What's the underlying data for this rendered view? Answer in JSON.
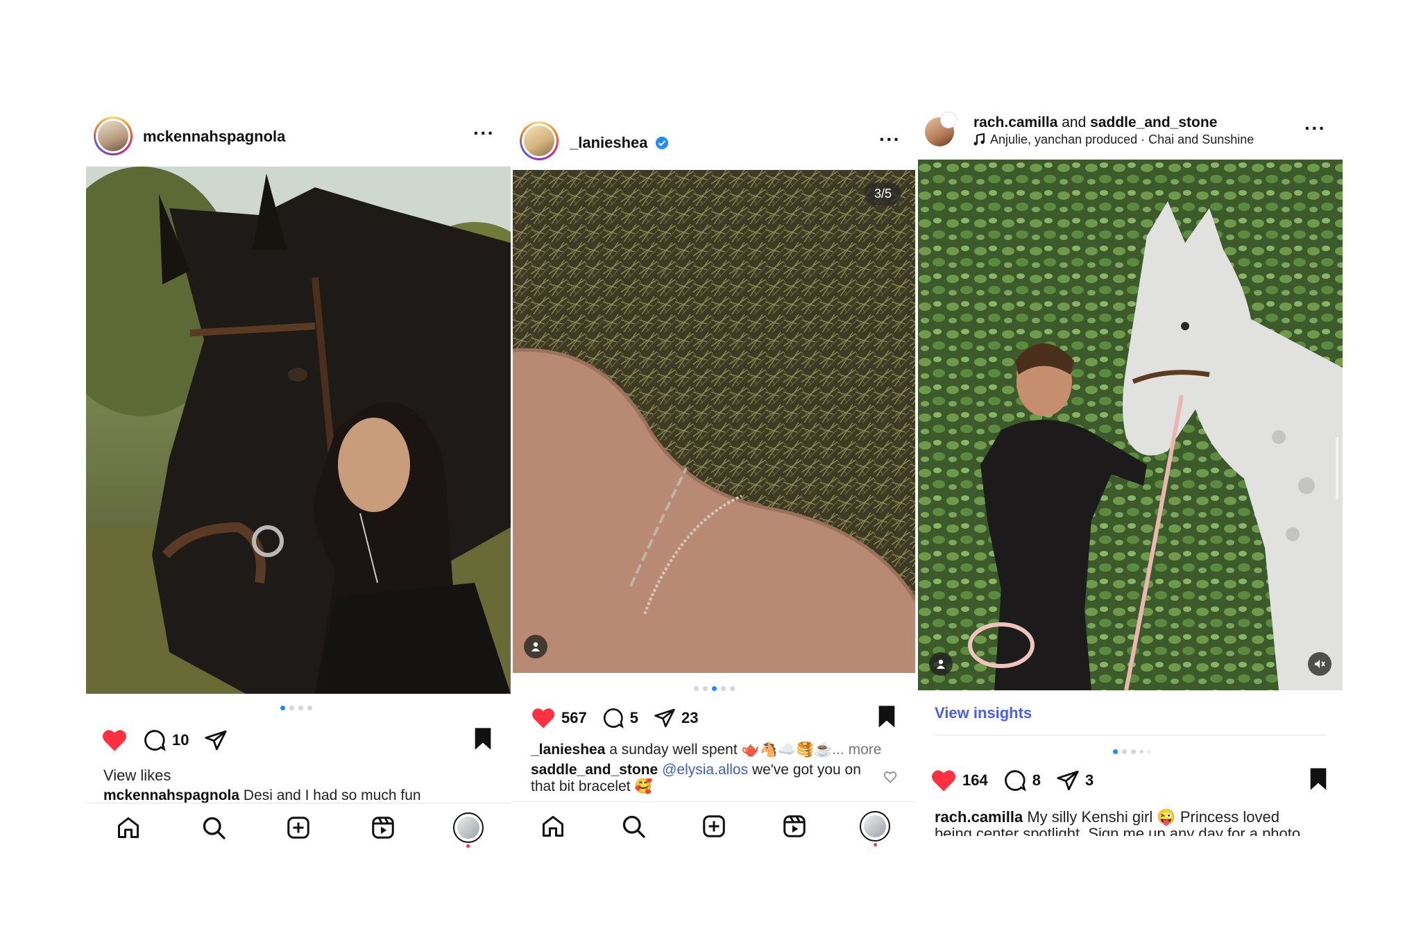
{
  "post1": {
    "username": "mckennahspagnola",
    "comment_count": "10",
    "view_likes": "View likes",
    "caption_user": "mckennahspagnola",
    "caption_text": "Desi and I had so much fun",
    "carousel_total": 4,
    "carousel_index": 1
  },
  "post2": {
    "username": "_lanieshea",
    "verified": true,
    "photo_counter": "3/5",
    "like_count": "567",
    "comment_count": "5",
    "share_count": "23",
    "caption_user": "_lanieshea",
    "caption_text": "a sunday well spent 🫖🐴☁️🥞☕",
    "caption_more": "... more",
    "comment_user": "saddle_and_stone",
    "comment_mention": "@elysia.allos",
    "comment_text": "we've got you on",
    "comment_text_2": "that bit bracelet 🥰",
    "carousel_total": 5,
    "carousel_index": 3
  },
  "post3": {
    "username_1": "rach.camilla",
    "joiner": "and",
    "username_2": "saddle_and_stone",
    "music": "Anjulie, yanchan produced · Chai and Sunshine",
    "view_insights": "View insights",
    "like_count": "164",
    "comment_count": "8",
    "share_count": "3",
    "caption_user": "rach.camilla",
    "caption_text": "My silly Kenshi girl 😜 Princess loved",
    "caption_text_2": "being center spotlight. Sign me up any day for a photo",
    "carousel_total": 5,
    "carousel_index": 1
  },
  "icons": {
    "like": "heart-icon",
    "comment": "comment-icon",
    "share": "send-icon",
    "save": "bookmark-icon",
    "nav": [
      "home-icon",
      "search-icon",
      "create-icon",
      "reels-icon",
      "profile-icon"
    ]
  },
  "colors": {
    "like_red": "#ff3040",
    "dot_active": "#1a8cff",
    "link_blue": "#3a5fcd",
    "insights_blue": "#4a5ee8"
  }
}
